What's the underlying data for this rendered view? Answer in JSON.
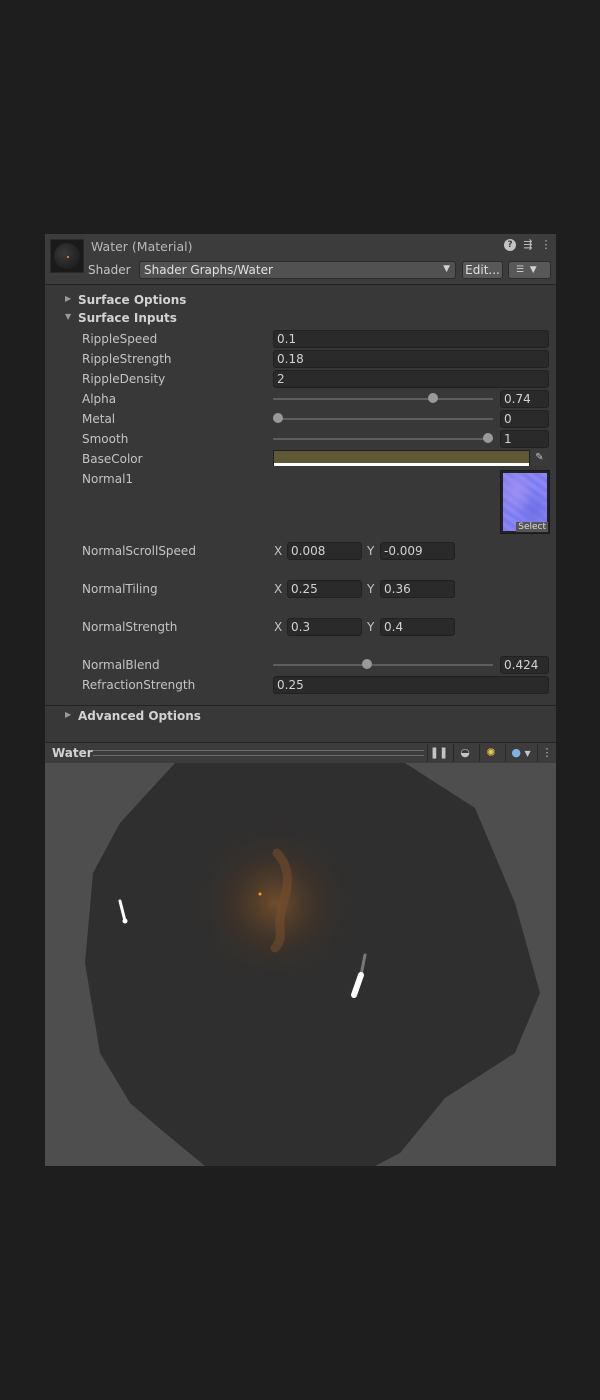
{
  "header": {
    "title": "Water (Material)",
    "shader_label": "Shader",
    "shader_value": "Shader Graphs/Water",
    "edit_label": "Edit...",
    "icons": [
      "help-icon",
      "sliders-icon",
      "kebab-menu-icon"
    ]
  },
  "sections": {
    "surface_options": "Surface Options",
    "surface_inputs": "Surface Inputs",
    "advanced_options": "Advanced Options"
  },
  "properties": {
    "ripple_speed": {
      "label": "RippleSpeed",
      "value": "0.1"
    },
    "ripple_strength": {
      "label": "RippleStrength",
      "value": "0.18"
    },
    "ripple_density": {
      "label": "RippleDensity",
      "value": "2"
    },
    "alpha": {
      "label": "Alpha",
      "value": "0.74",
      "fraction": 0.74
    },
    "metal": {
      "label": "Metal",
      "value": "0",
      "fraction": 0
    },
    "smooth": {
      "label": "Smooth",
      "value": "1",
      "fraction": 1
    },
    "base_color": {
      "label": "BaseColor",
      "color": "#5f5834"
    },
    "normal1": {
      "label": "Normal1",
      "select_label": "Select"
    },
    "normal_scroll_speed": {
      "label": "NormalScrollSpeed",
      "x_label": "X",
      "x": "0.008",
      "y_label": "Y",
      "y": "-0.009"
    },
    "normal_tiling": {
      "label": "NormalTiling",
      "x_label": "X",
      "x": "0.25",
      "y_label": "Y",
      "y": "0.36"
    },
    "normal_strength": {
      "label": "NormalStrength",
      "x_label": "X",
      "x": "0.3",
      "y_label": "Y",
      "y": "0.4"
    },
    "normal_blend": {
      "label": "NormalBlend",
      "value": "0.424",
      "fraction": 0.424
    },
    "refraction_strength": {
      "label": "RefractionStrength",
      "value": "0.25"
    }
  },
  "preview": {
    "label": "Water",
    "icons": [
      "pause-icon",
      "mesh-sphere-icon",
      "lights-icon",
      "background-sphere-icon",
      "kebab-menu-icon"
    ]
  },
  "colors": {
    "panel_bg": "#383838",
    "header_bg": "#3c3c3c",
    "field_bg": "#2a2a2a",
    "preview_bg": "#4e4e4e"
  }
}
